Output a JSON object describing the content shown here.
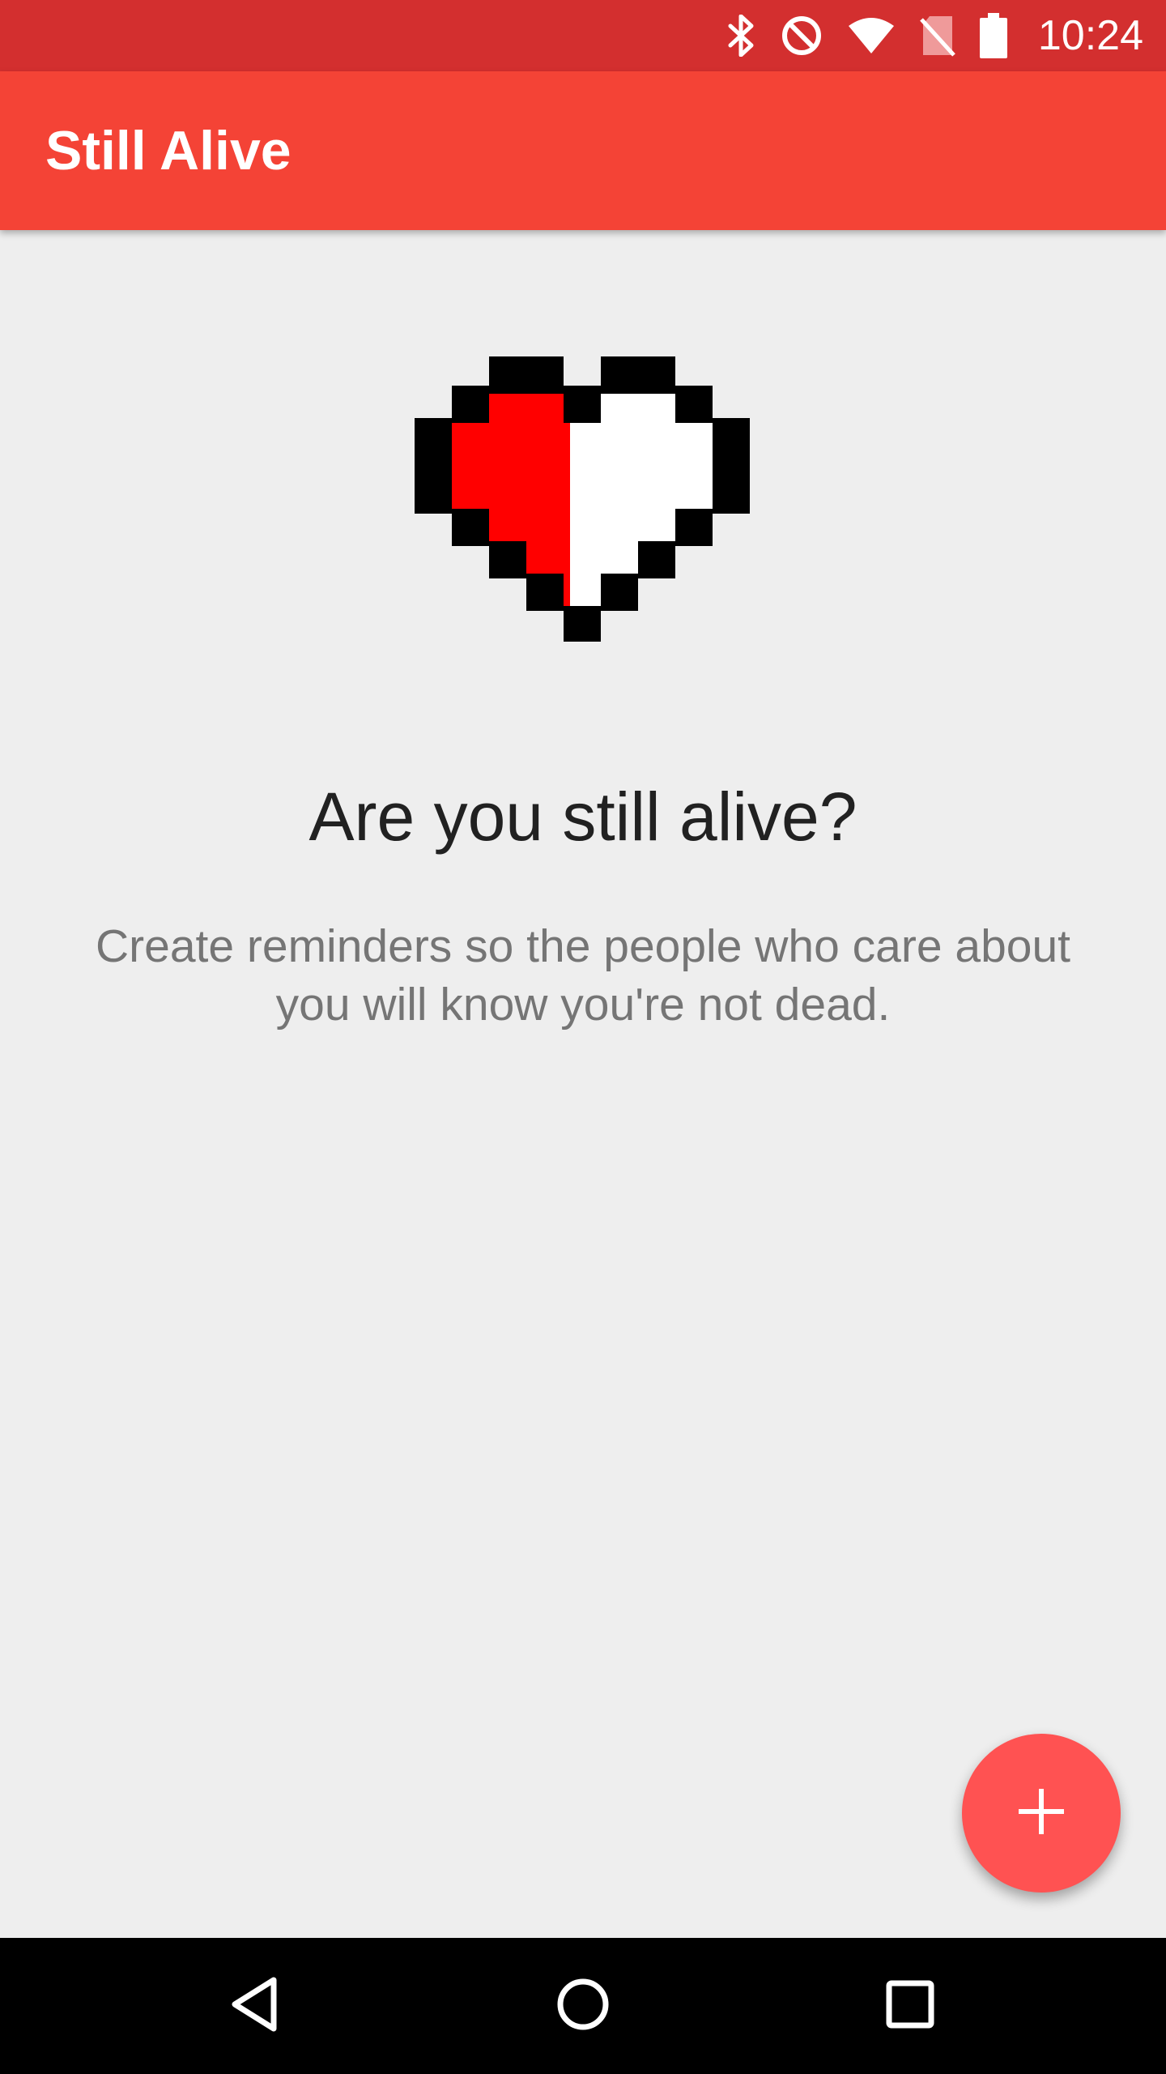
{
  "status_bar": {
    "time": "10:24",
    "icons": [
      "bluetooth-icon",
      "do-not-disturb-icon",
      "wifi-icon",
      "no-sim-icon",
      "battery-icon"
    ],
    "background": "#d32f2f"
  },
  "app_bar": {
    "title": "Still Alive",
    "background": "#f44336"
  },
  "main": {
    "illustration": "half-heart-icon",
    "headline": "Are you still alive?",
    "subtext": "Create reminders so the people who care about you will know you're not dead."
  },
  "fab": {
    "icon": "plus-icon",
    "color": "#ff5252"
  },
  "nav_bar": {
    "buttons": [
      "back-icon",
      "home-icon",
      "recents-icon"
    ]
  },
  "colors": {
    "heart_fill": "#ff0000",
    "heart_outline": "#000000",
    "heart_empty": "#ffffff"
  }
}
